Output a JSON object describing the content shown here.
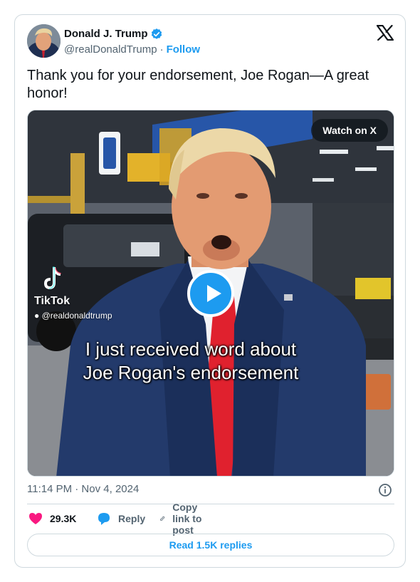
{
  "author": {
    "name": "Donald J. Trump",
    "handle": "@realDonaldTrump",
    "separator": "·",
    "follow_label": "Follow",
    "verified_icon": "verified-badge-icon",
    "avatar_icon": "avatar"
  },
  "brand_icon": "x-logo-icon",
  "tweet": {
    "text": "Thank you for your endorsement, Joe Rogan—A great honor!"
  },
  "media": {
    "watch_label": "Watch on X",
    "play_icon": "play-icon",
    "tiktok_label": "TikTok",
    "tiktok_user": "@realdonaldtrump",
    "caption_line1": "I just received word about",
    "caption_line2": "Joe Rogan's endorsement"
  },
  "meta": {
    "timestamp": "11:14 PM · Nov 4, 2024",
    "info_icon": "info-icon"
  },
  "actions": {
    "like_count": "29.3K",
    "reply_label": "Reply",
    "copy_label": "Copy link to post",
    "like_icon": "heart-icon",
    "reply_icon": "speech-bubble-icon",
    "copy_icon": "link-icon"
  },
  "read_replies_label": "Read 1.5K replies",
  "colors": {
    "accent": "#1d9bf0",
    "text_primary": "#0f1419",
    "text_secondary": "#536471",
    "border": "#cfd9de",
    "like": "#f91880",
    "tie_red": "#e0212e",
    "suit_navy": "#233a6b"
  }
}
